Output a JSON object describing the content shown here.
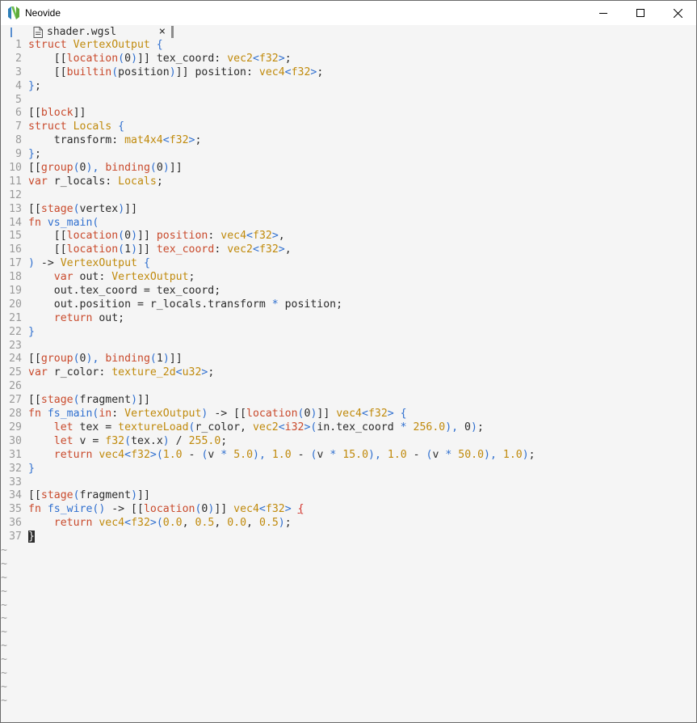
{
  "window": {
    "title": "Neovide",
    "icon": "neovim-logo-icon",
    "controls": [
      "minimize-icon",
      "maximize-icon",
      "close-icon"
    ]
  },
  "tabline": {
    "tab_label": "shader.wgsl",
    "tab_icon": "file-icon",
    "close_glyph": "×"
  },
  "colors": {
    "keyword": "#c94a2c",
    "type": "#c08a0c",
    "bracket": "#2f6fcf",
    "text": "#2b2b2b",
    "line_number": "#9a9a9a",
    "background": "#f5f5f5"
  },
  "editor": {
    "line_numbers": [
      "1",
      "2",
      "3",
      "4",
      "5",
      "6",
      "7",
      "8",
      "9",
      "10",
      "11",
      "12",
      "13",
      "14",
      "15",
      "16",
      "17",
      "18",
      "19",
      "20",
      "21",
      "22",
      "23",
      "24",
      "25",
      "26",
      "27",
      "28",
      "29",
      "30",
      "31",
      "32",
      "33",
      "34",
      "35",
      "36",
      "37"
    ],
    "tildes": [
      "~",
      "~",
      "~",
      "~",
      "~",
      "~",
      "~",
      "~",
      "~",
      "~",
      "~",
      "~"
    ],
    "lines": [
      [
        [
          "k",
          "struct "
        ],
        [
          "t",
          "VertexOutput "
        ],
        [
          "b",
          "{"
        ]
      ],
      [
        [
          "p",
          "    [["
        ],
        [
          "k",
          "location"
        ],
        [
          "b",
          "("
        ],
        [
          "p",
          "0"
        ],
        [
          "b",
          ")"
        ],
        [
          "p",
          "]] tex_coord: "
        ],
        [
          "t",
          "vec2"
        ],
        [
          "b",
          "<"
        ],
        [
          "t",
          "f32"
        ],
        [
          "b",
          ">"
        ],
        [
          "p",
          ";"
        ]
      ],
      [
        [
          "p",
          "    [["
        ],
        [
          "k",
          "builtin"
        ],
        [
          "b",
          "("
        ],
        [
          "p",
          "position"
        ],
        [
          "b",
          ")"
        ],
        [
          "p",
          "]] position: "
        ],
        [
          "t",
          "vec4"
        ],
        [
          "b",
          "<"
        ],
        [
          "t",
          "f32"
        ],
        [
          "b",
          ">"
        ],
        [
          "p",
          ";"
        ]
      ],
      [
        [
          "b",
          "}"
        ],
        [
          "p",
          ";"
        ]
      ],
      [],
      [
        [
          "p",
          "[["
        ],
        [
          "k",
          "block"
        ],
        [
          "p",
          "]]"
        ]
      ],
      [
        [
          "k",
          "struct "
        ],
        [
          "t",
          "Locals "
        ],
        [
          "b",
          "{"
        ]
      ],
      [
        [
          "p",
          "    transform: "
        ],
        [
          "t",
          "mat4x4"
        ],
        [
          "b",
          "<"
        ],
        [
          "t",
          "f32"
        ],
        [
          "b",
          ">"
        ],
        [
          "p",
          ";"
        ]
      ],
      [
        [
          "b",
          "}"
        ],
        [
          "p",
          ";"
        ]
      ],
      [
        [
          "p",
          "[["
        ],
        [
          "k",
          "group"
        ],
        [
          "b",
          "("
        ],
        [
          "p",
          "0"
        ],
        [
          "b",
          "), "
        ],
        [
          "k",
          "binding"
        ],
        [
          "b",
          "("
        ],
        [
          "p",
          "0"
        ],
        [
          "b",
          ")"
        ],
        [
          "p",
          "]]"
        ]
      ],
      [
        [
          "k",
          "var "
        ],
        [
          "p",
          "r_locals: "
        ],
        [
          "t",
          "Locals"
        ],
        [
          "p",
          ";"
        ]
      ],
      [],
      [
        [
          "p",
          "[["
        ],
        [
          "k",
          "stage"
        ],
        [
          "b",
          "("
        ],
        [
          "p",
          "vertex"
        ],
        [
          "b",
          ")"
        ],
        [
          "p",
          "]]"
        ]
      ],
      [
        [
          "k",
          "fn "
        ],
        [
          "b",
          "vs_main("
        ]
      ],
      [
        [
          "p",
          "    [["
        ],
        [
          "k",
          "location"
        ],
        [
          "b",
          "("
        ],
        [
          "p",
          "0"
        ],
        [
          "b",
          ")"
        ],
        [
          "p",
          "]] "
        ],
        [
          "k",
          "position"
        ],
        [
          "p",
          ": "
        ],
        [
          "t",
          "vec4"
        ],
        [
          "b",
          "<"
        ],
        [
          "t",
          "f32"
        ],
        [
          "b",
          ">"
        ],
        [
          "p",
          ","
        ]
      ],
      [
        [
          "p",
          "    [["
        ],
        [
          "k",
          "location"
        ],
        [
          "b",
          "("
        ],
        [
          "p",
          "1"
        ],
        [
          "b",
          ")"
        ],
        [
          "p",
          "]] "
        ],
        [
          "k",
          "tex_coord"
        ],
        [
          "p",
          ": "
        ],
        [
          "t",
          "vec2"
        ],
        [
          "b",
          "<"
        ],
        [
          "t",
          "f32"
        ],
        [
          "b",
          ">"
        ],
        [
          "p",
          ","
        ]
      ],
      [
        [
          "b",
          ")"
        ],
        [
          "p",
          " -> "
        ],
        [
          "t",
          "VertexOutput "
        ],
        [
          "b",
          "{"
        ]
      ],
      [
        [
          "k",
          "    var "
        ],
        [
          "p",
          "out: "
        ],
        [
          "t",
          "VertexOutput"
        ],
        [
          "p",
          ";"
        ]
      ],
      [
        [
          "p",
          "    out.tex_coord = tex_coord;"
        ]
      ],
      [
        [
          "p",
          "    out.position = r_locals.transform "
        ],
        [
          "b",
          "*"
        ],
        [
          "p",
          " position;"
        ]
      ],
      [
        [
          "k",
          "    return "
        ],
        [
          "p",
          "out;"
        ]
      ],
      [
        [
          "b",
          "}"
        ]
      ],
      [],
      [
        [
          "p",
          "[["
        ],
        [
          "k",
          "group"
        ],
        [
          "b",
          "("
        ],
        [
          "p",
          "0"
        ],
        [
          "b",
          "), "
        ],
        [
          "k",
          "binding"
        ],
        [
          "b",
          "("
        ],
        [
          "p",
          "1"
        ],
        [
          "b",
          ")"
        ],
        [
          "p",
          "]]"
        ]
      ],
      [
        [
          "k",
          "var "
        ],
        [
          "p",
          "r_color: "
        ],
        [
          "t",
          "texture_2d"
        ],
        [
          "b",
          "<"
        ],
        [
          "t",
          "u32"
        ],
        [
          "b",
          ">"
        ],
        [
          "p",
          ";"
        ]
      ],
      [],
      [
        [
          "p",
          "[["
        ],
        [
          "k",
          "stage"
        ],
        [
          "b",
          "("
        ],
        [
          "p",
          "fragment"
        ],
        [
          "b",
          ")"
        ],
        [
          "p",
          "]]"
        ]
      ],
      [
        [
          "k",
          "fn "
        ],
        [
          "b",
          "fs_main("
        ],
        [
          "k",
          "in"
        ],
        [
          "p",
          ": "
        ],
        [
          "t",
          "VertexOutput"
        ],
        [
          "b",
          ")"
        ],
        [
          "p",
          " -> [["
        ],
        [
          "k",
          "location"
        ],
        [
          "b",
          "("
        ],
        [
          "p",
          "0"
        ],
        [
          "b",
          ")"
        ],
        [
          "p",
          "]] "
        ],
        [
          "t",
          "vec4"
        ],
        [
          "b",
          "<"
        ],
        [
          "t",
          "f32"
        ],
        [
          "b",
          "> {"
        ]
      ],
      [
        [
          "k",
          "    let "
        ],
        [
          "p",
          "tex = "
        ],
        [
          "t",
          "textureLoad"
        ],
        [
          "b",
          "("
        ],
        [
          "p",
          "r_color, "
        ],
        [
          "t",
          "vec2"
        ],
        [
          "b",
          "<"
        ],
        [
          "k",
          "i32"
        ],
        [
          "b",
          ">("
        ],
        [
          "p",
          "in.tex_coord "
        ],
        [
          "b",
          "*"
        ],
        [
          "p",
          " "
        ],
        [
          "t",
          "256.0"
        ],
        [
          "b",
          "), "
        ],
        [
          "p",
          "0"
        ],
        [
          "b",
          ")"
        ],
        [
          "p",
          ";"
        ]
      ],
      [
        [
          "k",
          "    let "
        ],
        [
          "p",
          "v = "
        ],
        [
          "t",
          "f32"
        ],
        [
          "b",
          "("
        ],
        [
          "p",
          "tex.x"
        ],
        [
          "b",
          ")"
        ],
        [
          "p",
          " / "
        ],
        [
          "t",
          "255.0"
        ],
        [
          "p",
          ";"
        ]
      ],
      [
        [
          "k",
          "    return "
        ],
        [
          "t",
          "vec4"
        ],
        [
          "b",
          "<"
        ],
        [
          "t",
          "f32"
        ],
        [
          "b",
          ">("
        ],
        [
          "t",
          "1.0"
        ],
        [
          "p",
          " - "
        ],
        [
          "b",
          "("
        ],
        [
          "p",
          "v "
        ],
        [
          "b",
          "*"
        ],
        [
          "p",
          " "
        ],
        [
          "t",
          "5.0"
        ],
        [
          "b",
          "),"
        ],
        [
          "p",
          " "
        ],
        [
          "t",
          "1.0"
        ],
        [
          "p",
          " - "
        ],
        [
          "b",
          "("
        ],
        [
          "p",
          "v "
        ],
        [
          "b",
          "*"
        ],
        [
          "p",
          " "
        ],
        [
          "t",
          "15.0"
        ],
        [
          "b",
          "),"
        ],
        [
          "p",
          " "
        ],
        [
          "t",
          "1.0"
        ],
        [
          "p",
          " - "
        ],
        [
          "b",
          "("
        ],
        [
          "p",
          "v "
        ],
        [
          "b",
          "*"
        ],
        [
          "p",
          " "
        ],
        [
          "t",
          "50.0"
        ],
        [
          "b",
          "),"
        ],
        [
          "p",
          " "
        ],
        [
          "t",
          "1.0"
        ],
        [
          "b",
          ")"
        ],
        [
          "p",
          ";"
        ]
      ],
      [
        [
          "b",
          "}"
        ]
      ],
      [],
      [
        [
          "p",
          "[["
        ],
        [
          "k",
          "stage"
        ],
        [
          "b",
          "("
        ],
        [
          "p",
          "fragment"
        ],
        [
          "b",
          ")"
        ],
        [
          "p",
          "]]"
        ]
      ],
      [
        [
          "k",
          "fn "
        ],
        [
          "b",
          "fs_wire() "
        ],
        [
          "p",
          "-> [["
        ],
        [
          "k",
          "location"
        ],
        [
          "b",
          "("
        ],
        [
          "p",
          "0"
        ],
        [
          "b",
          ")"
        ],
        [
          "p",
          "]] "
        ],
        [
          "t",
          "vec4"
        ],
        [
          "b",
          "<"
        ],
        [
          "t",
          "f32"
        ],
        [
          "b",
          "> "
        ],
        [
          "ul",
          "{"
        ]
      ],
      [
        [
          "k",
          "    return "
        ],
        [
          "t",
          "vec4"
        ],
        [
          "b",
          "<"
        ],
        [
          "t",
          "f32"
        ],
        [
          "b",
          ">("
        ],
        [
          "t",
          "0.0"
        ],
        [
          "p",
          ", "
        ],
        [
          "t",
          "0.5"
        ],
        [
          "p",
          ", "
        ],
        [
          "t",
          "0.0"
        ],
        [
          "p",
          ", "
        ],
        [
          "t",
          "0.5"
        ],
        [
          "b",
          ")"
        ],
        [
          "p",
          ";"
        ]
      ],
      [
        [
          "cursor",
          "}"
        ]
      ]
    ]
  }
}
